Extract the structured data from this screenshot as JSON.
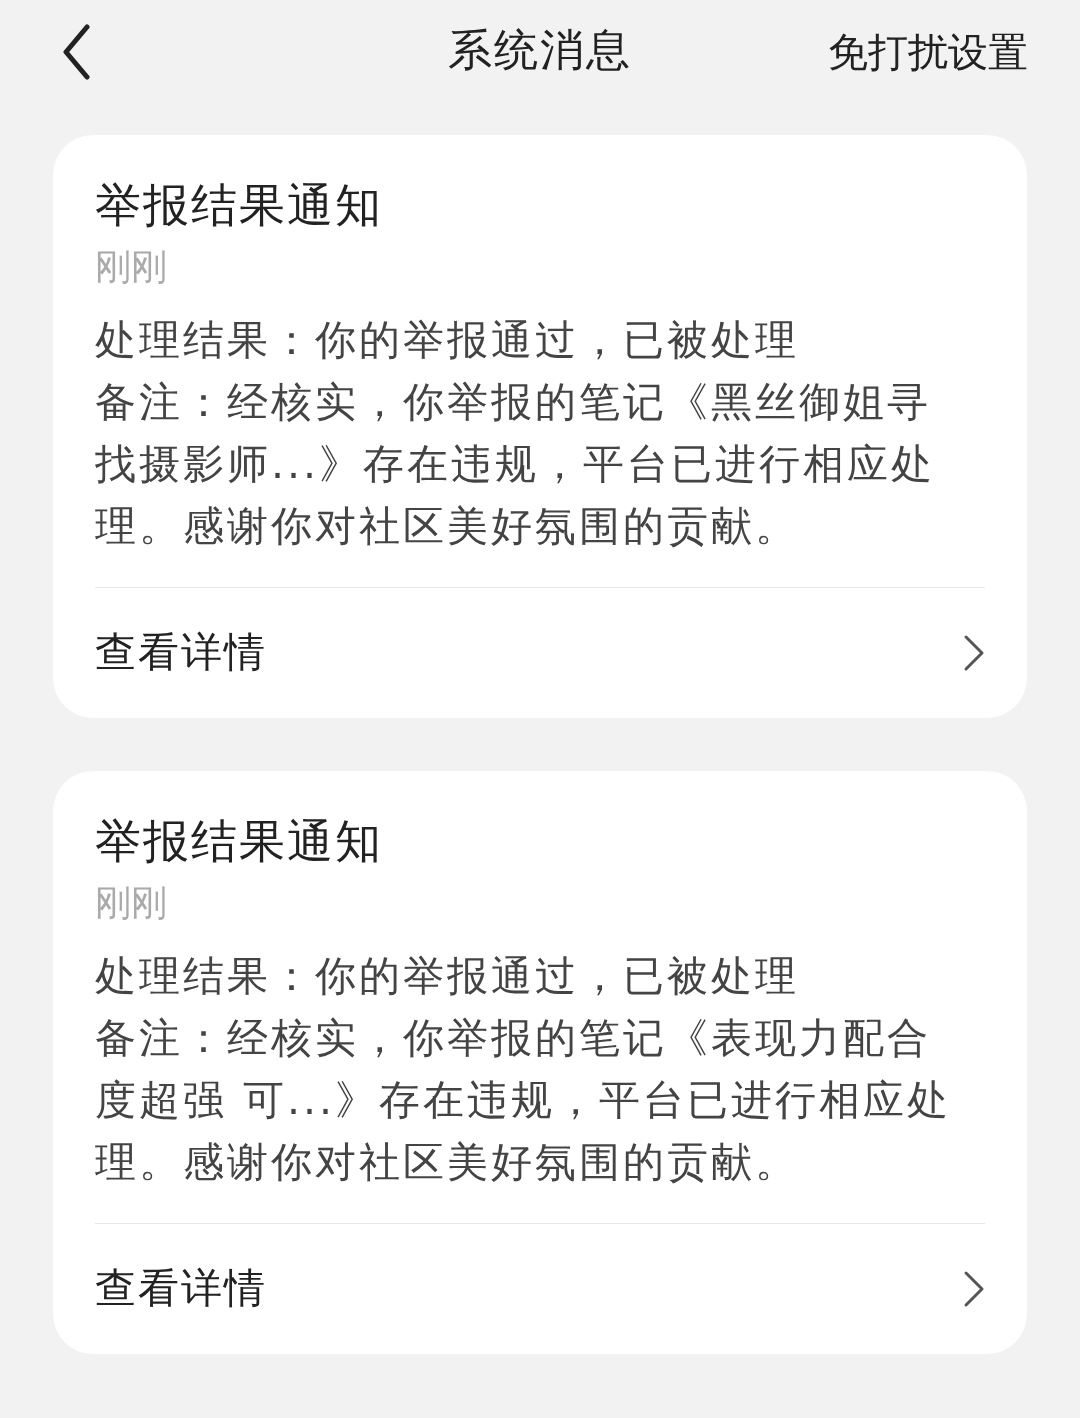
{
  "header": {
    "title": "系统消息",
    "action": "免打扰设置"
  },
  "messages": [
    {
      "title": "举报结果通知",
      "time": "刚刚",
      "result": "处理结果：你的举报通过，已被处理",
      "note": "备注：经核实，你举报的笔记《黑丝御姐寻找摄影师...》存在违规，平台已进行相应处理。感谢你对社区美好氛围的贡献。",
      "link": "查看详情"
    },
    {
      "title": "举报结果通知",
      "time": "刚刚",
      "result": "处理结果：你的举报通过，已被处理",
      "note": "备注：经核实，你举报的笔记《表现力配合度超强 可...》存在违规，平台已进行相应处理。感谢你对社区美好氛围的贡献。",
      "link": "查看详情"
    }
  ]
}
